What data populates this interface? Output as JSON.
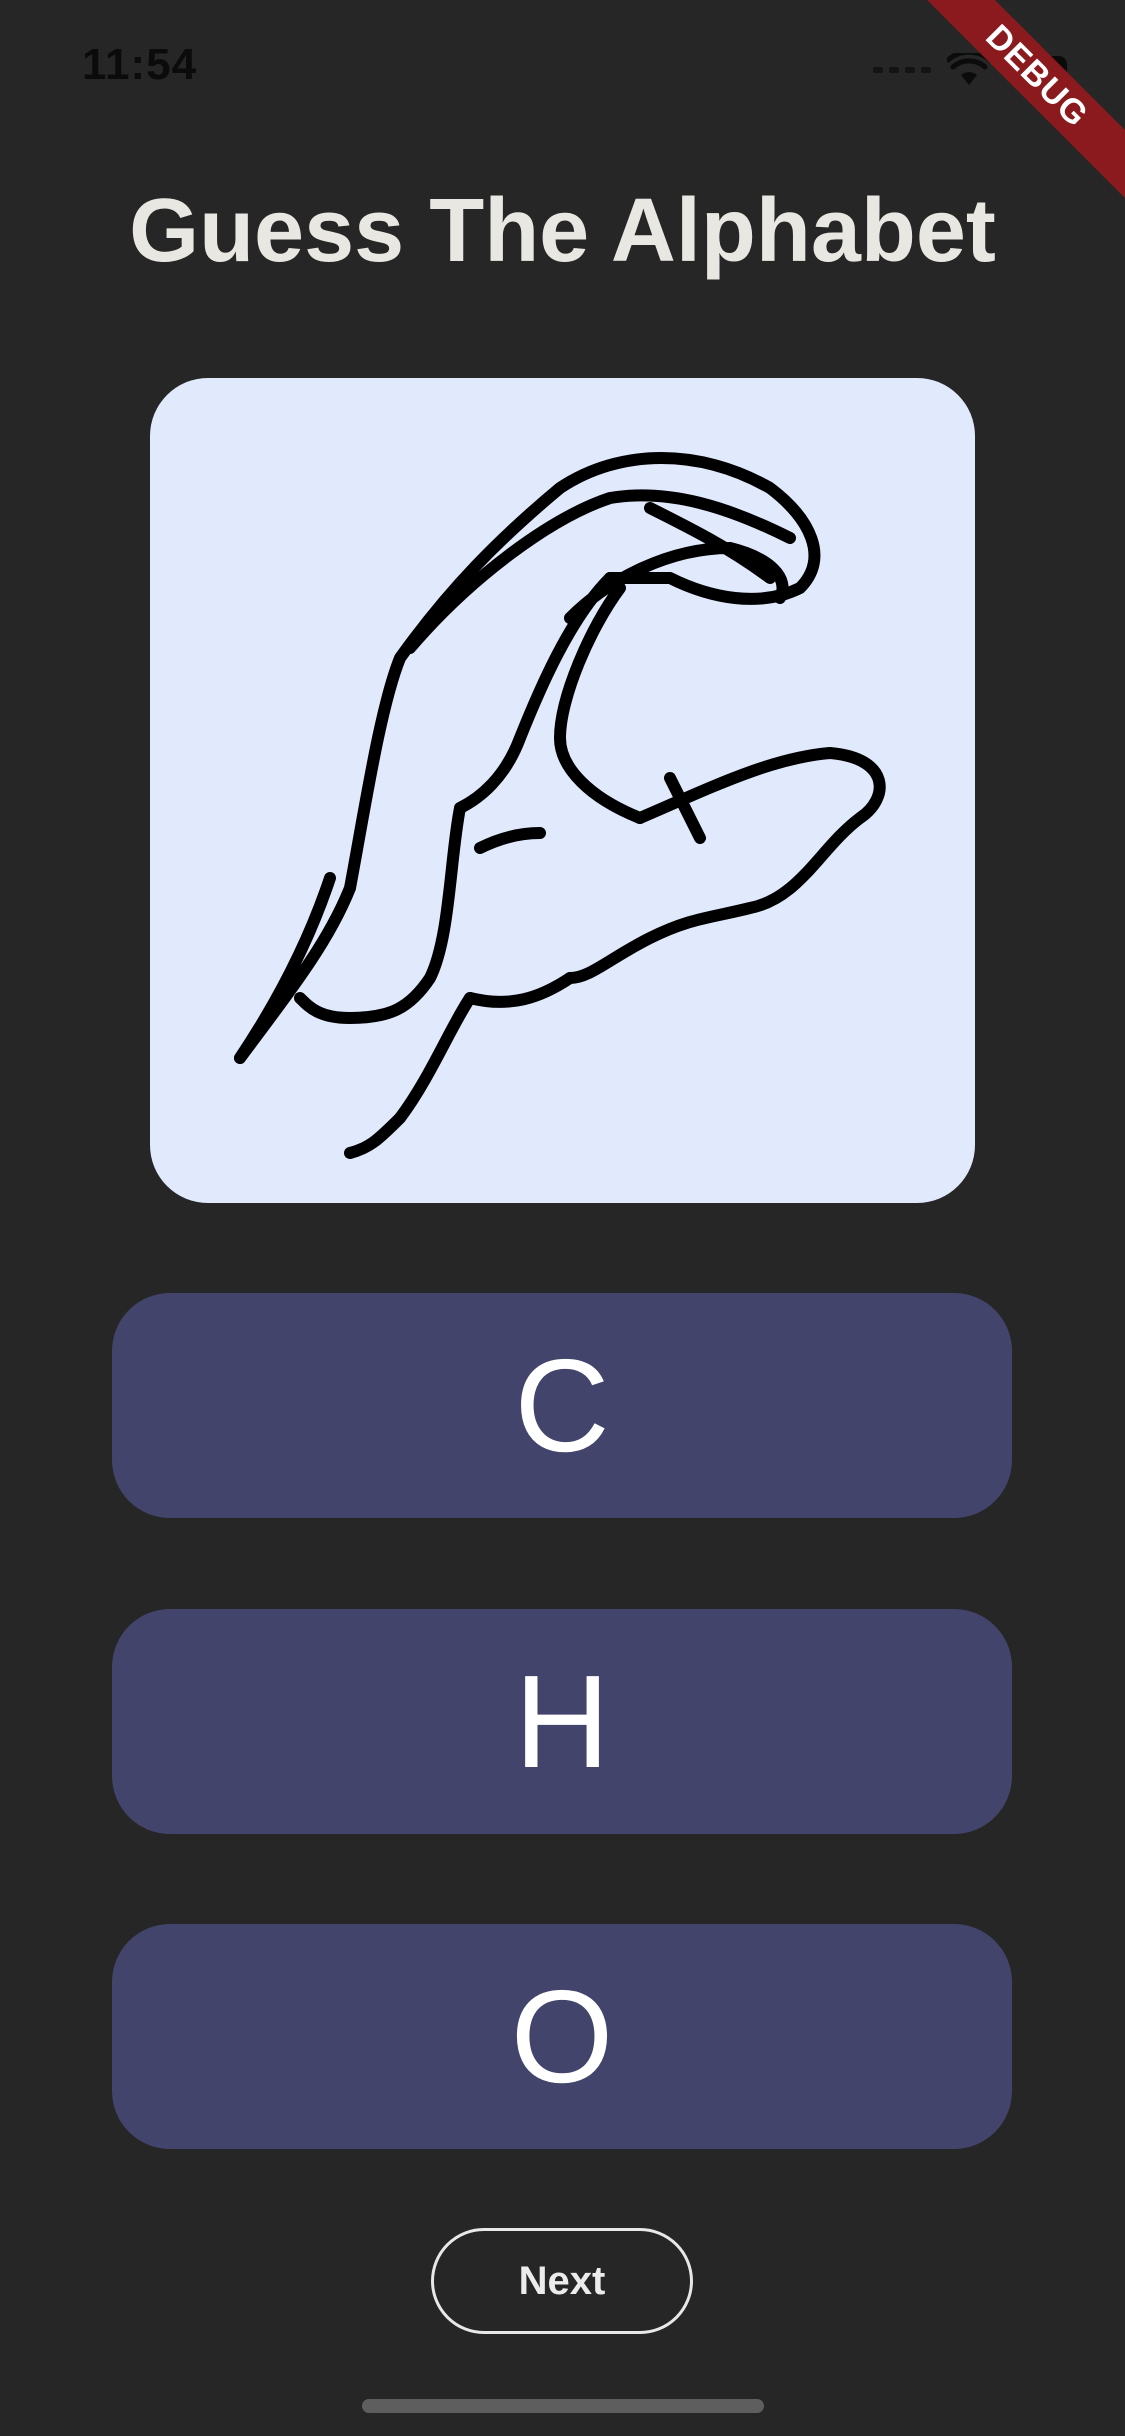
{
  "status_bar": {
    "time": "11:54"
  },
  "debug_banner": "DEBUG",
  "page": {
    "title": "Guess The Alphabet"
  },
  "question": {
    "image_alt": "hand sign"
  },
  "answers": [
    {
      "label": "C"
    },
    {
      "label": "H"
    },
    {
      "label": "O"
    }
  ],
  "next_button": {
    "label": "Next"
  },
  "colors": {
    "background": "#262626",
    "card": "#e1e9fd",
    "answer_button": "#42446b",
    "title": "#e9e7e2",
    "debug_banner": "#8b1a1f"
  }
}
